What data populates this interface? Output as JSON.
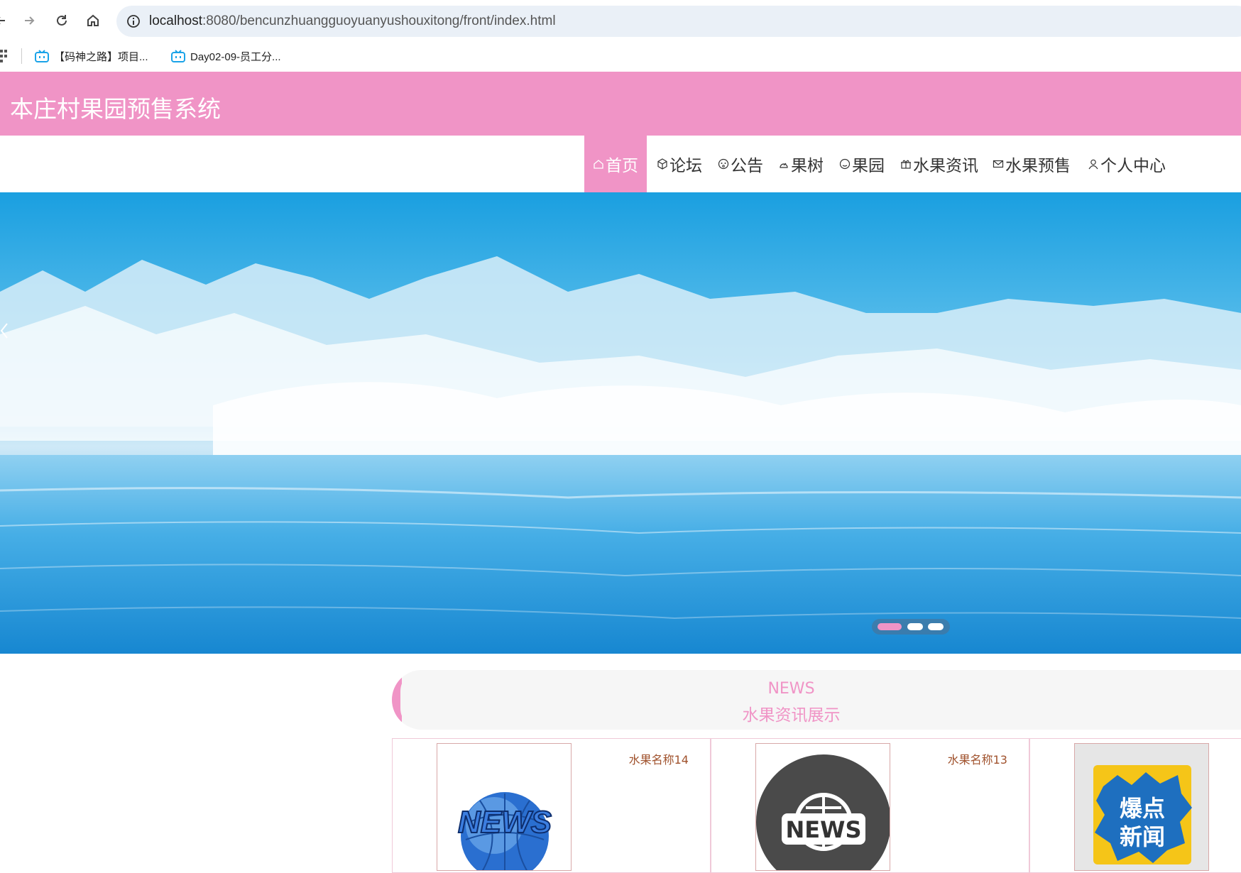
{
  "browser": {
    "url_host": "localhost",
    "url_rest": ":8080/bencunzhuangguoyuanyushouxitong/front/index.html",
    "bookmarks": [
      {
        "label": "【码神之路】项目..."
      },
      {
        "label": "Day02-09-员工分..."
      }
    ]
  },
  "site": {
    "title": "本庄村果园预售系统"
  },
  "nav": {
    "items": [
      {
        "label": "首页",
        "icon": "home-icon",
        "active": true
      },
      {
        "label": "论坛",
        "icon": "cube-icon"
      },
      {
        "label": "公告",
        "icon": "face-icon"
      },
      {
        "label": "果树",
        "icon": "cloud-icon"
      },
      {
        "label": "果园",
        "icon": "smile-icon"
      },
      {
        "label": "水果资讯",
        "icon": "gift-icon"
      },
      {
        "label": "水果预售",
        "icon": "mail-icon"
      },
      {
        "label": "个人中心",
        "icon": "user-icon"
      }
    ]
  },
  "banner": {
    "active_slide": 1,
    "slide_count": 3
  },
  "news": {
    "title_en": "NEWS",
    "title_cn": "水果资讯展示",
    "cards": [
      {
        "name": "水果名称14",
        "image": "news-globe-image"
      },
      {
        "name": "水果名称13",
        "image": "news-world-image"
      },
      {
        "name": "",
        "image": "hot-news-image",
        "image_text": "爆点新闻"
      }
    ]
  },
  "colors": {
    "accent": "#f094c6",
    "card_name": "#a0522d"
  }
}
